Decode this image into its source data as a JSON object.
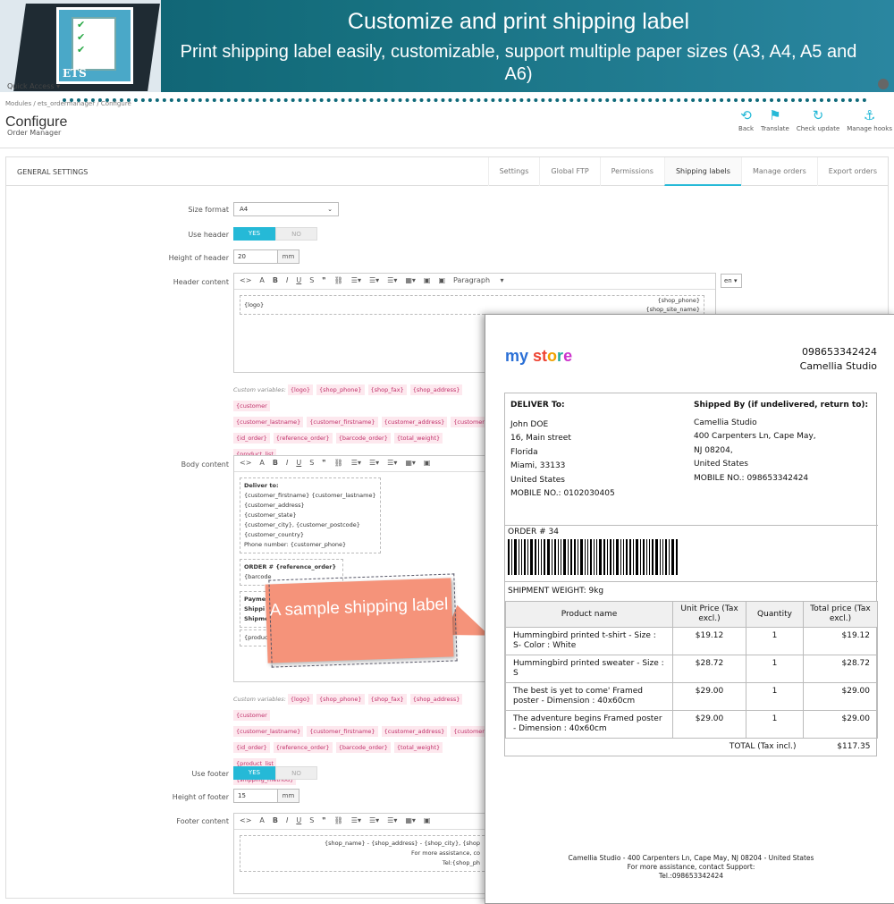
{
  "banner": {
    "title": "Customize and print shipping label",
    "subtitle": "Print shipping label easily, customizable, support multiple paper sizes (A3, A4, A5 and A6)",
    "logo_text": "ETS"
  },
  "admin": {
    "quick_access": "Quick Access",
    "breadcrumb": "Modules  /  ets_ordermanager  /  Configure",
    "page_title": "Configure",
    "page_subtitle": "Order Manager",
    "toolbar": [
      {
        "label": "Back",
        "icon": "arrow-left-icon"
      },
      {
        "label": "Translate",
        "icon": "flag-icon"
      },
      {
        "label": "Check update",
        "icon": "refresh-icon"
      },
      {
        "label": "Manage hooks",
        "icon": "anchor-icon"
      }
    ],
    "panel_title": "GENERAL SETTINGS",
    "tabs": [
      "Settings",
      "Global FTP",
      "Permissions",
      "Shipping labels",
      "Manage orders",
      "Export orders"
    ],
    "active_tab": "Shipping labels",
    "form": {
      "size_format_label": "Size format",
      "size_format_value": "A4",
      "use_header_label": "Use header",
      "yes": "YES",
      "no": "NO",
      "height_header_label": "Height of header",
      "height_header_value": "20",
      "unit": "mm",
      "header_content_label": "Header content",
      "paragraph": "Paragraph",
      "lang": "en",
      "header_logo": "{logo}",
      "header_phone": "{shop_phone}",
      "header_site": "{shop_site_name}",
      "custom_vars_label": "Custom variables:",
      "vars_row1": [
        "{logo}",
        "{shop_phone}",
        "{shop_fax}",
        "{shop_address}",
        "{customer"
      ],
      "vars_row2": [
        "{customer_lastname}",
        "{customer_firstname}",
        "{customer_address}",
        "{customer"
      ],
      "vars_row3": [
        "{id_order}",
        "{reference_order}",
        "{barcode_order}",
        "{total_weight}",
        "{product_list"
      ],
      "vars_row4": [
        "{shipping_method}"
      ],
      "body_content_label": "Body content",
      "body_deliver": "Deliver to:",
      "body_lines": [
        "{customer_firstname} {customer_lastname}",
        "{customer_address}",
        "{customer_state}",
        "{customer_city}, {customer_postcode}",
        "{customer_country}",
        "Phone number: {customer_phone}"
      ],
      "body_order": "ORDER # {reference_order}",
      "body_barcode": "{barcode",
      "body_pay": "Payme",
      "body_ship": "Shippi",
      "body_shipm": "Shipme",
      "body_product": "{product",
      "use_footer_label": "Use footer",
      "height_footer_label": "Height of footer",
      "height_footer_value": "15",
      "footer_content_label": "Footer content",
      "footer_line1": "{shop_name} - {shop_address} - {shop_city}, {shop",
      "footer_line2": "For more assistance, co",
      "footer_line3": "Tel:{shop_ph"
    }
  },
  "callout": "A sample shipping label",
  "label": {
    "store_logo": [
      "my",
      "st",
      "o",
      "r",
      "e"
    ],
    "shop_phone": "098653342424",
    "shop_name": "Camellia Studio",
    "deliver_title": "DELIVER To:",
    "deliver_lines": [
      "John DOE",
      "16, Main street",
      "Florida",
      "Miami, 33133",
      "United States"
    ],
    "deliver_mobile": "MOBILE NO.: 0102030405",
    "shipby_title": "Shipped By (if undelivered, return to):",
    "shipby_lines": [
      "Camellia Studio",
      "400 Carpenters Ln, Cape May,",
      "NJ 08204,",
      "United States"
    ],
    "shipby_mobile": "MOBILE NO.: 098653342424",
    "order": "ORDER # 34",
    "weight": "SHIPMENT WEIGHT: 9kg",
    "headers": [
      "Product name",
      "Unit Price (Tax excl.)",
      "Quantity",
      "Total price (Tax excl.)"
    ],
    "rows": [
      [
        "Hummingbird printed t-shirt - Size : S- Color : White",
        "$19.12",
        "1",
        "$19.12"
      ],
      [
        "Hummingbird printed sweater - Size : S",
        "$28.72",
        "1",
        "$28.72"
      ],
      [
        "The best is yet to come' Framed poster - Dimension : 40x60cm",
        "$29.00",
        "1",
        "$29.00"
      ],
      [
        "The adventure begins Framed poster - Dimension : 40x60cm",
        "$29.00",
        "1",
        "$29.00"
      ]
    ],
    "total_label": "TOTAL (Tax incl.)",
    "total_value": "$117.35",
    "footer_line1": "Camellia Studio - 400 Carpenters Ln, Cape May, NJ 08204 - United States",
    "footer_line2": "For more assistance, contact Support:",
    "footer_line3": "Tel.:098653342424"
  }
}
